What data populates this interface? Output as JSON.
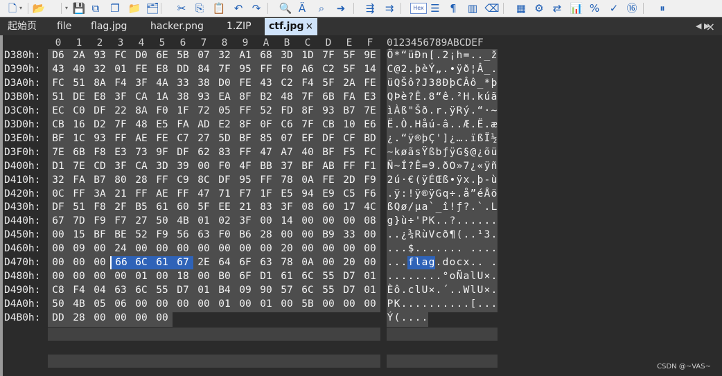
{
  "toolbar": {
    "icons": [
      "new-file-icon",
      "chevron-down-icon",
      "open-folder-icon",
      "chevron-down-icon",
      "save-icon",
      "save-all-icon",
      "copy-files-icon",
      "folder-icon",
      "folder-sync-icon",
      "cut-icon",
      "copy-icon",
      "paste-icon",
      "undo-icon",
      "redo-icon",
      "find-icon",
      "find-replace-icon",
      "find-in-files-icon",
      "goto-icon",
      "compare-icon",
      "compare-merge-icon",
      "hex-mode-icon",
      "format-icon",
      "paragraph-icon",
      "columns-icon",
      "clear-icon",
      "calculator-icon",
      "settings-icon",
      "swap-icon",
      "chart-icon",
      "percent-icon",
      "check-percent-icon",
      "base-convert-icon",
      "pause-icon"
    ],
    "hex_label": "Hex"
  },
  "tabs": [
    {
      "label": "起始页",
      "active": false
    },
    {
      "label": "file",
      "active": false
    },
    {
      "label": "flag.jpg",
      "active": false
    },
    {
      "label": "hacker.png",
      "active": false
    },
    {
      "label": "1.ZIP",
      "active": false
    },
    {
      "label": "ctf.jpg",
      "active": true,
      "close": "×"
    }
  ],
  "column_header": [
    "0",
    "1",
    "2",
    "3",
    "4",
    "5",
    "6",
    "7",
    "8",
    "9",
    "A",
    "B",
    "C",
    "D",
    "E",
    "F"
  ],
  "ascii_header": "0123456789ABCDEF",
  "rows": [
    {
      "offset": "D380h:",
      "bytes": [
        "D6",
        "2A",
        "93",
        "FC",
        "D0",
        "6E",
        "5B",
        "07",
        "32",
        "A1",
        "68",
        "3D",
        "1D",
        "7F",
        "5F",
        "9E"
      ],
      "ascii": "Ö*“üÐn[.2¡h=.._ž"
    },
    {
      "offset": "D390h:",
      "bytes": [
        "43",
        "40",
        "32",
        "01",
        "FE",
        "E8",
        "DD",
        "84",
        "7F",
        "95",
        "FF",
        "F0",
        "A6",
        "C2",
        "5F",
        "14"
      ],
      "ascii": "C@2.þèÝ„.•ÿð¦Â_."
    },
    {
      "offset": "D3A0h:",
      "bytes": [
        "FC",
        "51",
        "8A",
        "F4",
        "3F",
        "4A",
        "33",
        "38",
        "D0",
        "FE",
        "43",
        "C2",
        "F4",
        "5F",
        "2A",
        "FE"
      ],
      "ascii": "üQŠô?J38ÐþCÂô_*þ"
    },
    {
      "offset": "D3B0h:",
      "bytes": [
        "51",
        "DE",
        "E8",
        "3F",
        "CA",
        "1A",
        "38",
        "93",
        "EA",
        "8F",
        "B2",
        "48",
        "7F",
        "6B",
        "FA",
        "E3"
      ],
      "ascii": "QÞè?Ê.8“ê.²H.kúã"
    },
    {
      "offset": "D3C0h:",
      "bytes": [
        "EC",
        "C0",
        "DF",
        "22",
        "8A",
        "F0",
        "1F",
        "72",
        "05",
        "FF",
        "52",
        "FD",
        "8F",
        "93",
        "B7",
        "7E"
      ],
      "ascii": "ìÀß\"Šð.r.ÿRý.“·~"
    },
    {
      "offset": "D3D0h:",
      "bytes": [
        "CB",
        "16",
        "D2",
        "7F",
        "48",
        "E5",
        "FA",
        "AD",
        "E2",
        "8F",
        "0F",
        "C6",
        "7F",
        "CB",
        "10",
        "E6"
      ],
      "ascii": "Ë.Ò.Håú-â..Æ.Ë.æ"
    },
    {
      "offset": "D3E0h:",
      "bytes": [
        "BF",
        "1C",
        "93",
        "FF",
        "AE",
        "FE",
        "C7",
        "27",
        "5D",
        "BF",
        "85",
        "07",
        "EF",
        "DF",
        "CF",
        "BD"
      ],
      "ascii": "¿.“ÿ®þÇ']¿….ïßÏ½"
    },
    {
      "offset": "D3F0h:",
      "bytes": [
        "7E",
        "6B",
        "F8",
        "E3",
        "73",
        "9F",
        "DF",
        "62",
        "83",
        "FF",
        "47",
        "A7",
        "40",
        "BF",
        "F5",
        "FC"
      ],
      "ascii": "~køãsŸßbƒÿG§@¿õü"
    },
    {
      "offset": "D400h:",
      "bytes": [
        "D1",
        "7E",
        "CD",
        "3F",
        "CA",
        "3D",
        "39",
        "00",
        "F0",
        "4F",
        "BB",
        "37",
        "BF",
        "AB",
        "FF",
        "F1"
      ],
      "ascii": "Ñ~Í?Ê=9.ðO»7¿«ÿñ"
    },
    {
      "offset": "D410h:",
      "bytes": [
        "32",
        "FA",
        "B7",
        "80",
        "28",
        "FF",
        "C9",
        "8C",
        "DF",
        "95",
        "FF",
        "78",
        "0A",
        "FE",
        "2D",
        "F9"
      ],
      "ascii": "2ú·€(ÿÉŒß•ÿx.þ-ù"
    },
    {
      "offset": "D420h:",
      "bytes": [
        "0C",
        "FF",
        "3A",
        "21",
        "FF",
        "AE",
        "FF",
        "47",
        "71",
        "F7",
        "1F",
        "E5",
        "94",
        "E9",
        "C5",
        "F6"
      ],
      "ascii": ".ÿ:!ÿ®ÿGq÷.å”éÅö"
    },
    {
      "offset": "D430h:",
      "bytes": [
        "DF",
        "51",
        "F8",
        "2F",
        "B5",
        "61",
        "60",
        "5F",
        "EE",
        "21",
        "83",
        "3F",
        "08",
        "60",
        "17",
        "4C"
      ],
      "ascii": "ßQø/µa`_î!ƒ?.`.L"
    },
    {
      "offset": "D440h:",
      "bytes": [
        "67",
        "7D",
        "F9",
        "F7",
        "27",
        "50",
        "4B",
        "01",
        "02",
        "3F",
        "00",
        "14",
        "00",
        "00",
        "00",
        "08"
      ],
      "ascii": "g}ù÷'PK..?......"
    },
    {
      "offset": "D450h:",
      "bytes": [
        "00",
        "15",
        "BF",
        "BE",
        "52",
        "F9",
        "56",
        "63",
        "F0",
        "B6",
        "28",
        "00",
        "00",
        "B9",
        "33",
        "00"
      ],
      "ascii": "..¿¾RùVcð¶(..¹3."
    },
    {
      "offset": "D460h:",
      "bytes": [
        "00",
        "09",
        "00",
        "24",
        "00",
        "00",
        "00",
        "00",
        "00",
        "00",
        "00",
        "20",
        "00",
        "00",
        "00",
        "00"
      ],
      "ascii": "...$....... ...."
    },
    {
      "offset": "D470h:",
      "bytes": [
        "00",
        "00",
        "00",
        "66",
        "6C",
        "61",
        "67",
        "2E",
        "64",
        "6F",
        "63",
        "78",
        "0A",
        "00",
        "20",
        "00"
      ],
      "ascii": "...flag.docx.. ."
    },
    {
      "offset": "D480h:",
      "bytes": [
        "00",
        "00",
        "00",
        "00",
        "01",
        "00",
        "18",
        "00",
        "B0",
        "6F",
        "D1",
        "61",
        "6C",
        "55",
        "D7",
        "01"
      ],
      "ascii": "........°oÑalU×."
    },
    {
      "offset": "D490h:",
      "bytes": [
        "C8",
        "F4",
        "04",
        "63",
        "6C",
        "55",
        "D7",
        "01",
        "B4",
        "09",
        "90",
        "57",
        "6C",
        "55",
        "D7",
        "01"
      ],
      "ascii": "Èô.clU×.´..WlU×."
    },
    {
      "offset": "D4A0h:",
      "bytes": [
        "50",
        "4B",
        "05",
        "06",
        "00",
        "00",
        "00",
        "00",
        "01",
        "00",
        "01",
        "00",
        "5B",
        "00",
        "00",
        "00"
      ],
      "ascii": "PK..........[..."
    },
    {
      "offset": "D4B0h:",
      "bytes": [
        "DD",
        "28",
        "00",
        "00",
        "00",
        "00"
      ],
      "ascii": "Ý(...."
    }
  ],
  "selection": {
    "row": 15,
    "start": 3,
    "end": 6
  },
  "colors": {
    "selection": "#2f63b8",
    "editor_bg": "#2b2b2b",
    "data_bg": "#4d4d4d"
  },
  "watermark": "CSDN @~VAS~"
}
